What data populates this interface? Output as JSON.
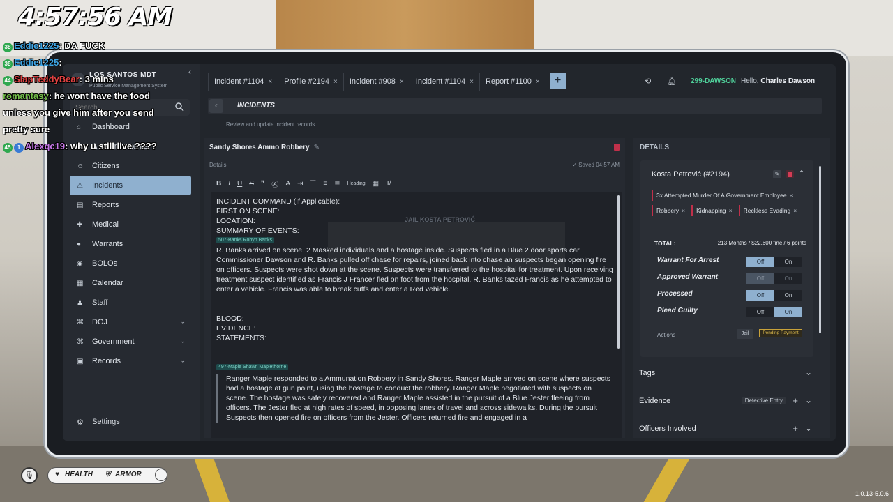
{
  "overlay": {
    "clock": "4:57:56 AM",
    "version": "1.0.13-5.0.6",
    "chat": [
      {
        "badges": [
          "38"
        ],
        "user": "Eddie1225",
        "text": ": DA FUCK",
        "color": "u1"
      },
      {
        "badges": [
          "38"
        ],
        "user": "Eddie1225",
        "text": ":",
        "color": "u1"
      },
      {
        "badges": [
          "44"
        ],
        "user": "SlapTeddyBear",
        "text": ": 3 mins",
        "color": "u2"
      },
      {
        "badges": [],
        "user": "romantasy",
        "text": ": he wont have the food unless you give him after you send pretty sure",
        "color": "u4"
      },
      {
        "badges": [
          "45",
          "1"
        ],
        "user": "Alexqc19",
        "text": ": why u still live ????",
        "color": "u3"
      }
    ],
    "hud": {
      "health": "HEALTH",
      "armor": "ARMOR"
    }
  },
  "app": {
    "logo_title": "LOS SANTOS MDT",
    "logo_sub": "Public Service Management System",
    "search_placeholder": "Search..."
  },
  "sidebar": {
    "items": [
      {
        "label": "Dashboard",
        "icon": "dashboard-icon",
        "glyph": "⌂"
      },
      {
        "label": "Announcements",
        "icon": "megaphone-icon",
        "glyph": "✉"
      },
      {
        "label": "Citizens",
        "icon": "users-icon",
        "glyph": "☺"
      },
      {
        "label": "Incidents",
        "icon": "alert-icon",
        "glyph": "⚠",
        "active": true
      },
      {
        "label": "Reports",
        "icon": "report-icon",
        "glyph": "▤"
      },
      {
        "label": "Medical",
        "icon": "medical-icon",
        "glyph": "✚"
      },
      {
        "label": "Warrants",
        "icon": "warrant-icon",
        "glyph": "●"
      },
      {
        "label": "BOLOs",
        "icon": "bolo-icon",
        "glyph": "◉"
      },
      {
        "label": "Calendar",
        "icon": "calendar-icon",
        "glyph": "▦"
      },
      {
        "label": "Staff",
        "icon": "staff-icon",
        "glyph": "♟"
      },
      {
        "label": "DOJ",
        "icon": "bank-icon",
        "glyph": "⌘",
        "expandable": true
      },
      {
        "label": "Government",
        "icon": "government-icon",
        "glyph": "⌘",
        "expandable": true
      },
      {
        "label": "Records",
        "icon": "records-icon",
        "glyph": "▣",
        "expandable": true
      }
    ],
    "settings": "Settings"
  },
  "header": {
    "tabs": [
      "Incident #1104",
      "Profile #2194",
      "Incident #908",
      "Incident #1104",
      "Report #1100"
    ],
    "callsign": "299-DAWSON",
    "greeting": "Hello,",
    "user": "Charles Dawson"
  },
  "breadcrumb": {
    "title": "INCIDENTS",
    "subtitle": "Review and update incident records"
  },
  "editor": {
    "title": "Sandy Shores Ammo Robbery",
    "label": "Details",
    "saved": "✓ Saved 04:57 AM",
    "heading": "Heading",
    "lines": [
      "INCIDENT COMMAND (If Applicable):",
      "FIRST ON SCENE:",
      "LOCATION:",
      "SUMMARY OF EVENTS:"
    ],
    "tag1": "507-Banks Robyn Banks",
    "para1": "R. Banks arrived on scene. 2 Masked individuals and a hostage inside. Suspects fled in a Blue 2 door sports car. Commissioner Dawson and R. Banks pulled off chase for repairs, joined back into chase an suspects began opening fire on officers. Suspects were shot down at the scene. Suspects were transferred to the hospital for treatment. Upon receiving treatment suspect identified as Francis J Francer fled on foot from the hospital. R. Banks tazed Francis as he attempted to enter a vehicle. Francis was able to break cuffs and enter a Red vehicle.",
    "lines2": [
      "BLOOD:",
      "EVIDENCE:",
      "STATEMENTS:"
    ],
    "tag2": "497-Maple Shawn Maplethorne",
    "para2": "Ranger Maple responded to a Ammunation Robbery in Sandy Shores. Ranger Maple arrived on scene where suspects had a hostage at gun point, using the hostage to conduct the robbery. Ranger Maple negotiated with suspects on scene. The hostage was safely recovered and Ranger Maple assisted in the pursuit of a Blue Jester fleeing from officers. The Jester fled at high rates of speed, in opposing lanes of travel and across sidewalks. During the pursuit Suspects then opened fire on officers from the Jester. Officers returned fire and engaged in a",
    "ghost": "JAIL KOSTA PETROVIĆ"
  },
  "details": {
    "heading": "DETAILS",
    "person": "Kosta Petrović (#2194)",
    "charges": [
      "3x Attempted Murder Of A Government Employee",
      "Robbery",
      "Kidnapping",
      "Reckless Evading"
    ],
    "total_label": "TOTAL:",
    "total_value": "213 Months / $22,600 fine / 6 points",
    "toggles": [
      {
        "label": "Warrant For Arrest",
        "off": "Off",
        "on": "On",
        "value": "off",
        "dim": false
      },
      {
        "label": "Approved Warrant",
        "off": "Off",
        "on": "On",
        "value": "off",
        "dim": true
      },
      {
        "label": "Processed",
        "off": "Off",
        "on": "On",
        "value": "off",
        "dim": false
      },
      {
        "label": "Plead Guilty",
        "off": "Off",
        "on": "On",
        "value": "on",
        "dim": false
      }
    ],
    "actions": "Actions",
    "jail": "Jail",
    "pending": "Pending Payment",
    "sections": [
      {
        "label": "Tags"
      },
      {
        "label": "Evidence",
        "badge": "Detective Entry",
        "plus": true
      },
      {
        "label": "Officers Involved",
        "plus": true
      }
    ]
  }
}
